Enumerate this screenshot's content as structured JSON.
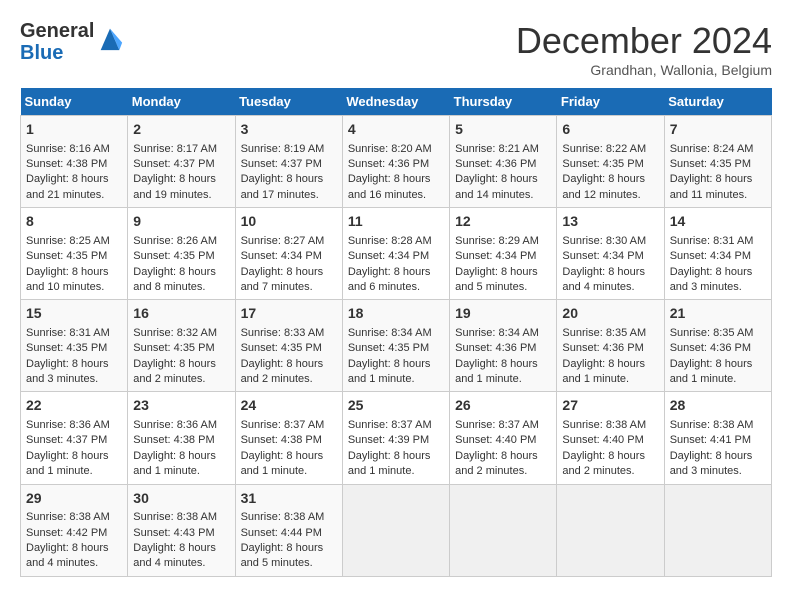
{
  "header": {
    "logo_general": "General",
    "logo_blue": "Blue",
    "month_title": "December 2024",
    "subtitle": "Grandhan, Wallonia, Belgium"
  },
  "days_of_week": [
    "Sunday",
    "Monday",
    "Tuesday",
    "Wednesday",
    "Thursday",
    "Friday",
    "Saturday"
  ],
  "weeks": [
    [
      {
        "day": "1",
        "sunrise": "8:16 AM",
        "sunset": "4:38 PM",
        "daylight": "8 hours and 21 minutes."
      },
      {
        "day": "2",
        "sunrise": "8:17 AM",
        "sunset": "4:37 PM",
        "daylight": "8 hours and 19 minutes."
      },
      {
        "day": "3",
        "sunrise": "8:19 AM",
        "sunset": "4:37 PM",
        "daylight": "8 hours and 17 minutes."
      },
      {
        "day": "4",
        "sunrise": "8:20 AM",
        "sunset": "4:36 PM",
        "daylight": "8 hours and 16 minutes."
      },
      {
        "day": "5",
        "sunrise": "8:21 AM",
        "sunset": "4:36 PM",
        "daylight": "8 hours and 14 minutes."
      },
      {
        "day": "6",
        "sunrise": "8:22 AM",
        "sunset": "4:35 PM",
        "daylight": "8 hours and 12 minutes."
      },
      {
        "day": "7",
        "sunrise": "8:24 AM",
        "sunset": "4:35 PM",
        "daylight": "8 hours and 11 minutes."
      }
    ],
    [
      {
        "day": "8",
        "sunrise": "8:25 AM",
        "sunset": "4:35 PM",
        "daylight": "8 hours and 10 minutes."
      },
      {
        "day": "9",
        "sunrise": "8:26 AM",
        "sunset": "4:35 PM",
        "daylight": "8 hours and 8 minutes."
      },
      {
        "day": "10",
        "sunrise": "8:27 AM",
        "sunset": "4:34 PM",
        "daylight": "8 hours and 7 minutes."
      },
      {
        "day": "11",
        "sunrise": "8:28 AM",
        "sunset": "4:34 PM",
        "daylight": "8 hours and 6 minutes."
      },
      {
        "day": "12",
        "sunrise": "8:29 AM",
        "sunset": "4:34 PM",
        "daylight": "8 hours and 5 minutes."
      },
      {
        "day": "13",
        "sunrise": "8:30 AM",
        "sunset": "4:34 PM",
        "daylight": "8 hours and 4 minutes."
      },
      {
        "day": "14",
        "sunrise": "8:31 AM",
        "sunset": "4:34 PM",
        "daylight": "8 hours and 3 minutes."
      }
    ],
    [
      {
        "day": "15",
        "sunrise": "8:31 AM",
        "sunset": "4:35 PM",
        "daylight": "8 hours and 3 minutes."
      },
      {
        "day": "16",
        "sunrise": "8:32 AM",
        "sunset": "4:35 PM",
        "daylight": "8 hours and 2 minutes."
      },
      {
        "day": "17",
        "sunrise": "8:33 AM",
        "sunset": "4:35 PM",
        "daylight": "8 hours and 2 minutes."
      },
      {
        "day": "18",
        "sunrise": "8:34 AM",
        "sunset": "4:35 PM",
        "daylight": "8 hours and 1 minute."
      },
      {
        "day": "19",
        "sunrise": "8:34 AM",
        "sunset": "4:36 PM",
        "daylight": "8 hours and 1 minute."
      },
      {
        "day": "20",
        "sunrise": "8:35 AM",
        "sunset": "4:36 PM",
        "daylight": "8 hours and 1 minute."
      },
      {
        "day": "21",
        "sunrise": "8:35 AM",
        "sunset": "4:36 PM",
        "daylight": "8 hours and 1 minute."
      }
    ],
    [
      {
        "day": "22",
        "sunrise": "8:36 AM",
        "sunset": "4:37 PM",
        "daylight": "8 hours and 1 minute."
      },
      {
        "day": "23",
        "sunrise": "8:36 AM",
        "sunset": "4:38 PM",
        "daylight": "8 hours and 1 minute."
      },
      {
        "day": "24",
        "sunrise": "8:37 AM",
        "sunset": "4:38 PM",
        "daylight": "8 hours and 1 minute."
      },
      {
        "day": "25",
        "sunrise": "8:37 AM",
        "sunset": "4:39 PM",
        "daylight": "8 hours and 1 minute."
      },
      {
        "day": "26",
        "sunrise": "8:37 AM",
        "sunset": "4:40 PM",
        "daylight": "8 hours and 2 minutes."
      },
      {
        "day": "27",
        "sunrise": "8:38 AM",
        "sunset": "4:40 PM",
        "daylight": "8 hours and 2 minutes."
      },
      {
        "day": "28",
        "sunrise": "8:38 AM",
        "sunset": "4:41 PM",
        "daylight": "8 hours and 3 minutes."
      }
    ],
    [
      {
        "day": "29",
        "sunrise": "8:38 AM",
        "sunset": "4:42 PM",
        "daylight": "8 hours and 4 minutes."
      },
      {
        "day": "30",
        "sunrise": "8:38 AM",
        "sunset": "4:43 PM",
        "daylight": "8 hours and 4 minutes."
      },
      {
        "day": "31",
        "sunrise": "8:38 AM",
        "sunset": "4:44 PM",
        "daylight": "8 hours and 5 minutes."
      },
      null,
      null,
      null,
      null
    ]
  ],
  "labels": {
    "sunrise": "Sunrise:",
    "sunset": "Sunset:",
    "daylight": "Daylight hours"
  }
}
